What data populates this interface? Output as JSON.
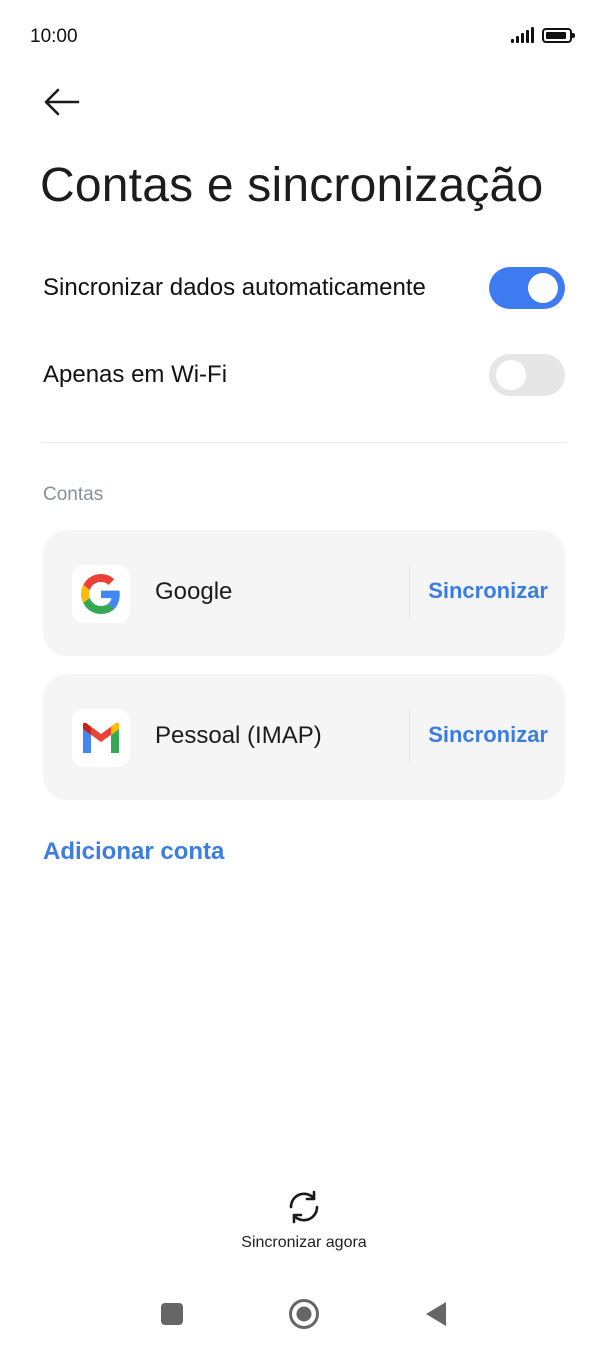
{
  "status_bar": {
    "time": "10:00",
    "battery_level": 0.9
  },
  "header": {
    "title": "Contas e sincronização",
    "back_icon": "arrow-left-icon"
  },
  "settings": {
    "auto_sync": {
      "label": "Sincronizar dados automaticamente",
      "enabled": true
    },
    "wifi_only": {
      "label": "Apenas em Wi-Fi",
      "enabled": false
    }
  },
  "accounts_section": {
    "label": "Contas",
    "accounts": [
      {
        "name": "Google",
        "icon": "google-icon",
        "sync_label": "Sincronizar"
      },
      {
        "name": "Pessoal (IMAP)",
        "icon": "gmail-icon",
        "sync_label": "Sincronizar"
      }
    ],
    "add_account_label": "Adicionar conta"
  },
  "bottom_action": {
    "label": "Sincronizar agora",
    "icon": "sync-icon"
  },
  "nav_bar": {
    "items": [
      "recents-icon",
      "home-icon",
      "back-icon"
    ]
  },
  "colors": {
    "accent": "#3f7bf0",
    "link": "#3b7de0",
    "toggle_off": "#e6e6e6",
    "card_bg": "#f5f5f5"
  }
}
